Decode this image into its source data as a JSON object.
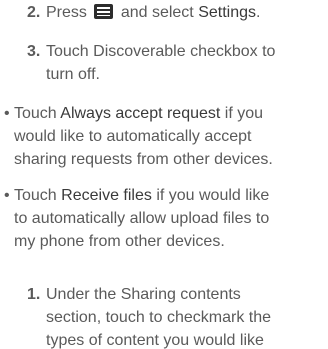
{
  "steps_top": [
    {
      "num": "2.",
      "before": "Press",
      "icon": "menu-icon",
      "after": "and select",
      "term": "Settings",
      "end": "."
    },
    {
      "num": "3.",
      "lines": [
        "Touch Discoverable checkbox to",
        "turn off."
      ]
    }
  ],
  "bullets": [
    {
      "dot": "•",
      "before": "Touch",
      "term": "Always accept request",
      "after_first": "if you",
      "lines": [
        "would like to automatically accept",
        "sharing requests from other devices."
      ]
    },
    {
      "dot": "•",
      "before": "Touch",
      "term": "Receive files",
      "after_first": "if you would like",
      "lines": [
        "to automatically allow upload files to",
        "my phone from other devices."
      ]
    }
  ],
  "steps_bottom": [
    {
      "num": "1.",
      "lines": [
        "Under the Sharing contents",
        "section, touch to checkmark the",
        "types of content you would like"
      ]
    }
  ]
}
